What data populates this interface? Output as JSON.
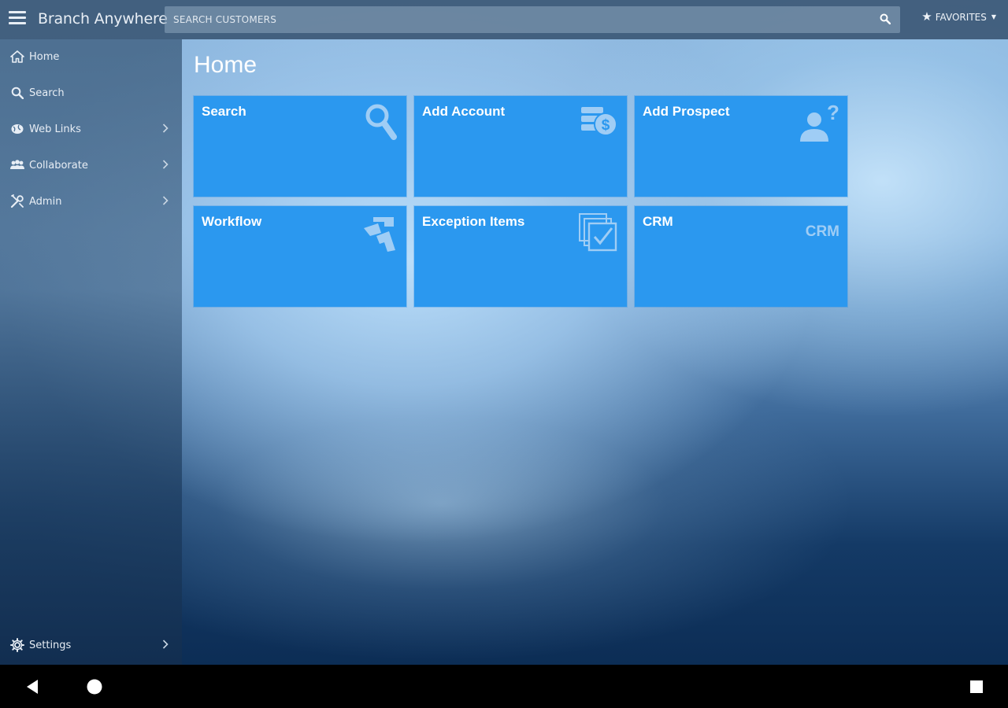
{
  "header": {
    "app_title": "Branch Anywhere",
    "search_placeholder": "SEARCH CUSTOMERS",
    "favorites_label": "FAVORITES"
  },
  "sidebar": {
    "items": [
      {
        "label": "Home",
        "icon": "home-icon"
      },
      {
        "label": "Search",
        "icon": "search-icon"
      },
      {
        "label": "Web Links",
        "icon": "globe-icon"
      },
      {
        "label": "Collaborate",
        "icon": "group-icon"
      },
      {
        "label": "Admin",
        "icon": "tools-icon"
      }
    ],
    "settings_label": "Settings"
  },
  "main": {
    "page_title": "Home",
    "tiles": [
      {
        "label": "Search",
        "icon": "magnifier-icon"
      },
      {
        "label": "Add Account",
        "icon": "money-stack-icon"
      },
      {
        "label": "Add Prospect",
        "icon": "person-question-icon"
      },
      {
        "label": "Workflow",
        "icon": "workflow-arrows-icon"
      },
      {
        "label": "Exception Items",
        "icon": "checklist-stack-icon"
      },
      {
        "label": "CRM",
        "icon": "crm-text-icon",
        "icon_text": "CRM"
      }
    ]
  },
  "colors": {
    "tile": "#2b98ef",
    "topbar": "#3c5876",
    "text": "#ffffff"
  }
}
